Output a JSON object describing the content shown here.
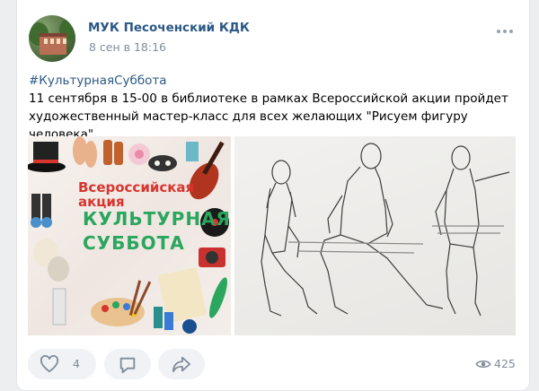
{
  "post": {
    "author": "МУК Песоченский КДК",
    "date": "8 сен в 18:16",
    "hashtag": "#КультурнаяСуббота",
    "text": "11 сентября в 15-00 в библиотеке в рамках Всероссийской акции пройдет художественный мастер-класс для всех желающих \"Рисуем фигуру человека\"."
  },
  "images": {
    "banner_title": "Всероссийская акция",
    "banner_main_line1": "КУЛЬТУРНАЯ",
    "banner_main_line2": "СУББОТА"
  },
  "actions": {
    "likes": "4",
    "views": "425",
    "icons": [
      "heart-icon",
      "comment-icon",
      "share-icon",
      "eye-icon",
      "more-icon"
    ]
  },
  "colors": {
    "link": "#2a5885",
    "secondary": "#818c99",
    "banner_red": "#d8352f",
    "banner_green": "#2aa65e"
  }
}
